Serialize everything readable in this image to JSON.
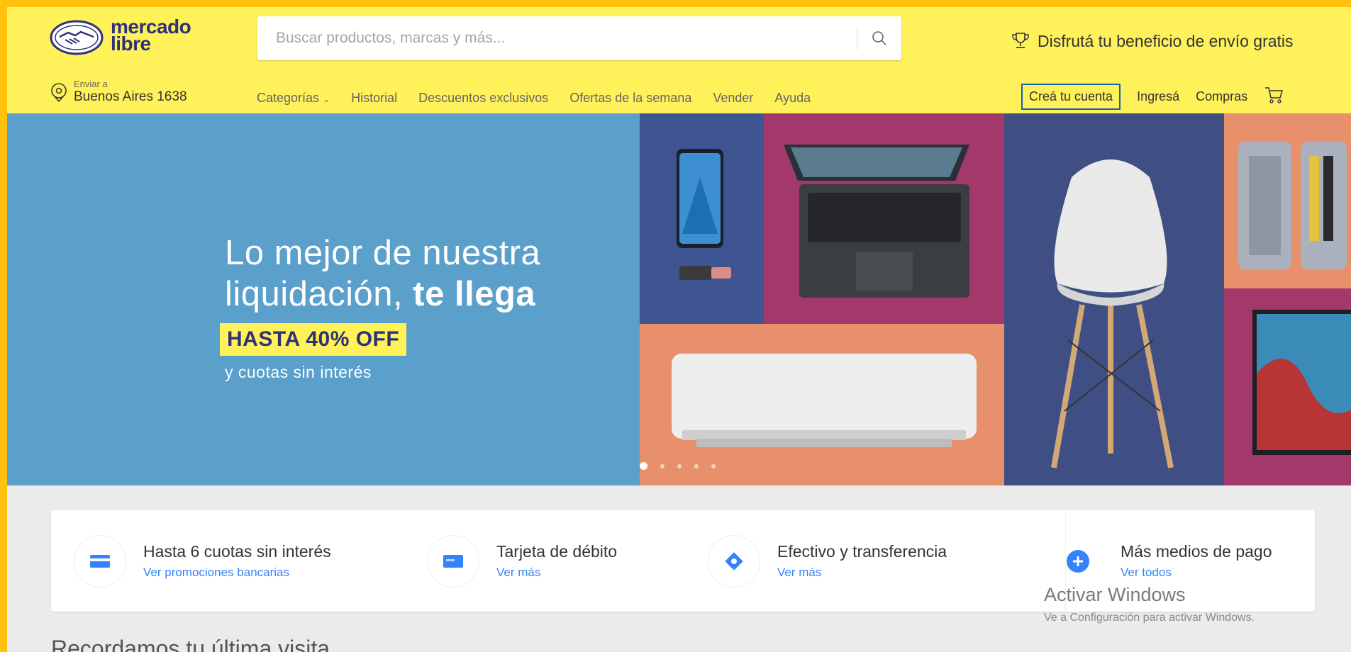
{
  "header": {
    "logo": {
      "line1": "mercado",
      "line2": "libre"
    },
    "search": {
      "placeholder": "Buscar productos, marcas y más..."
    },
    "promo": "Disfrutá tu beneficio de envío gratis",
    "location": {
      "label": "Enviar a",
      "value": "Buenos Aires 1638"
    },
    "nav": [
      "Categorías",
      "Historial",
      "Descuentos exclusivos",
      "Ofertas de la semana",
      "Vender",
      "Ayuda"
    ],
    "account": {
      "create": "Creá tu cuenta",
      "login": "Ingresá",
      "purchases": "Compras"
    }
  },
  "hero": {
    "title_line1": "Lo mejor de nuestra",
    "title_line2_regular": "liquidación,",
    "title_line2_bold": "te llega",
    "badge": "HASTA 40% OFF",
    "subtitle": "y cuotas sin interés",
    "slides_total": 5,
    "slide_active": 1
  },
  "payment": [
    {
      "title": "Hasta 6 cuotas sin interés",
      "link": "Ver promociones bancarias",
      "icon": "credit-card-icon"
    },
    {
      "title": "Tarjeta de débito",
      "link": "Ver más",
      "icon": "debit-card-icon"
    },
    {
      "title": "Efectivo y transferencia",
      "link": "Ver más",
      "icon": "cash-transfer-icon"
    },
    {
      "title": "Más medios de pago",
      "link": "Ver todos",
      "icon": "plus-icon"
    }
  ],
  "watermark": {
    "title": "Activar Windows",
    "subtitle": "Ve a Configuración para activar Windows."
  },
  "recent": "Recordamos tu última visita",
  "colors": {
    "header_bg": "#fff159",
    "hero_bg": "#5b9fcb",
    "link": "#3483fa",
    "brand_blue": "#2d3277"
  }
}
